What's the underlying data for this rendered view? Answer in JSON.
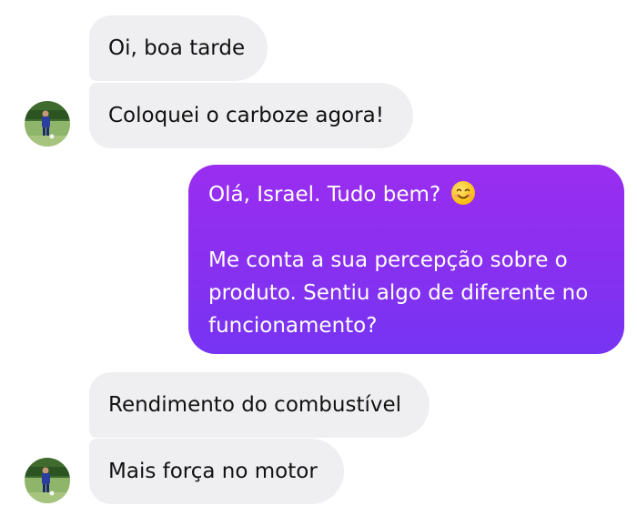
{
  "thread": {
    "group1": {
      "messages": [
        "Oi, boa tarde",
        "Coloquei o carboze agora!"
      ]
    },
    "reply": {
      "line1": "Olá, Israel. Tudo bem?",
      "emoji": "smiling-face-icon",
      "line2": "Me conta a sua percepção sobre o produto. Sentiu algo de diferente no funcionamento?"
    },
    "group2": {
      "messages": [
        "Rendimento do combustível",
        "Mais força no motor"
      ]
    }
  },
  "colors": {
    "incoming_bubble": "#efeff1",
    "outgoing_top": "#9a2ef0",
    "outgoing_bottom": "#7634f2"
  }
}
